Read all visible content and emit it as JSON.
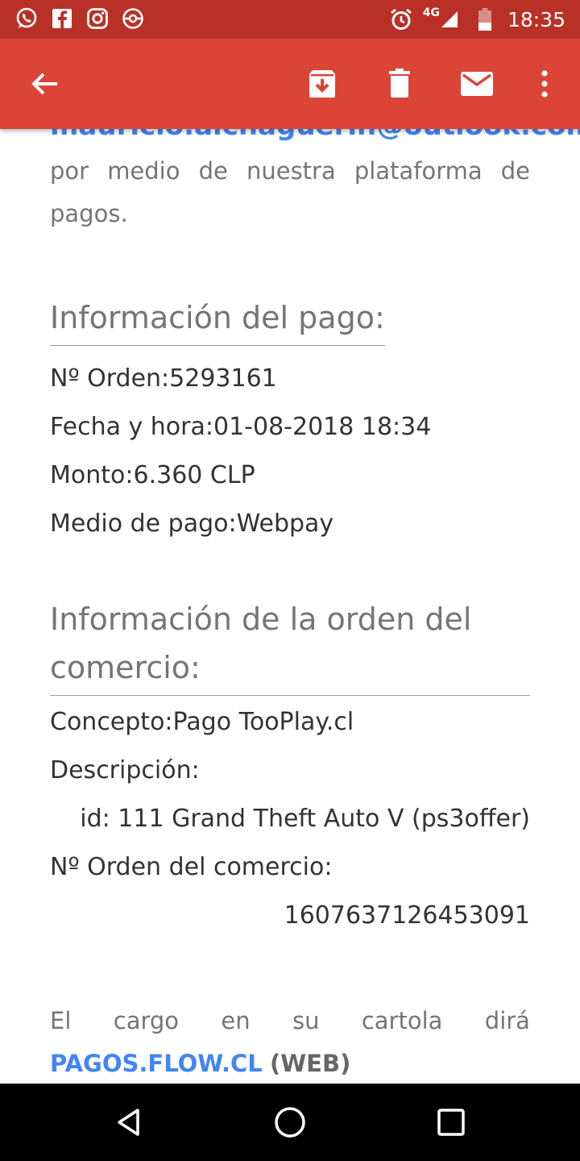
{
  "status_bar": {
    "notification_icons": [
      "whatsapp-icon",
      "facebook-icon",
      "instagram-icon",
      "pokeball-icon"
    ],
    "network": "4G",
    "time": "18:35"
  },
  "app_bar": {
    "actions": [
      "back-arrow-icon",
      "archive-icon",
      "delete-icon",
      "mail-icon",
      "more-vert-icon"
    ],
    "colors": {
      "bar": "#db4437",
      "status": "#b93126"
    }
  },
  "email": {
    "cut_email": "mauricio.aichaguerin@outlook.com",
    "intro_line1_words": [
      "por",
      "medio",
      "de",
      "nuestra",
      "plataforma",
      "de"
    ],
    "intro_line2": "pagos.",
    "payment_info": {
      "heading": "Información del pago:",
      "order_label": "Nº Orden:",
      "order_value": "5293161",
      "date_label": "Fecha y hora:",
      "date_value": "01-08-2018 18:34",
      "amount_label": "Monto:",
      "amount_value": "6.360 CLP",
      "method_label": "Medio de pago:",
      "method_value": "Webpay"
    },
    "order_info": {
      "heading_line1": "Información de la orden del",
      "heading_line2": "comercio:",
      "concept_label": "Concepto:",
      "concept_value": "Pago TooPlay.cl",
      "description_label": "Descripción:",
      "description_value": "id: 111 Grand Theft Auto V (ps3offer)",
      "merchant_order_label": "Nº Orden del comercio:",
      "merchant_order_value": "1607637126453091"
    },
    "footer_words": [
      "El",
      "cargo",
      "en",
      "su",
      "cartola",
      "dirá"
    ],
    "footer_link": "PAGOS.FLOW.CL",
    "footer_suffix": "(WEB)"
  },
  "nav_bar": {
    "buttons": [
      "back-triangle-icon",
      "home-circle-icon",
      "recents-square-icon"
    ]
  }
}
